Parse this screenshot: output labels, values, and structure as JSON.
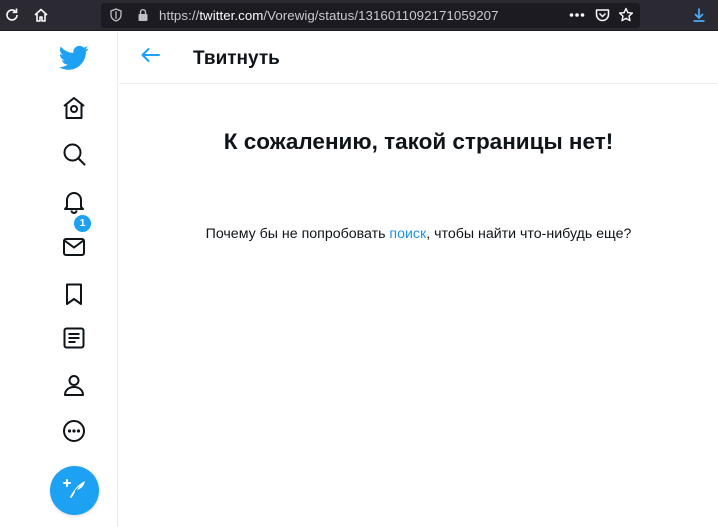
{
  "browser": {
    "url_host": "twitter.com",
    "url_path": "/Vorewig/status/1316011092171059207",
    "url_prefix": "https://",
    "icons": [
      "reload-icon",
      "home-icon",
      "tracking-protection-icon",
      "lock-icon",
      "page-actions-icon",
      "pocket-icon",
      "bookmark-star-icon",
      "download-icon"
    ],
    "accent_color": "#4aa8f5"
  },
  "nav": {
    "items": [
      "twitter-logo-icon",
      "home-icon",
      "explore-icon",
      "notifications-icon",
      "messages-icon",
      "bookmarks-icon",
      "lists-icon",
      "profile-icon",
      "more-icon"
    ],
    "notification_count": "1",
    "tweet_button_icon": "compose-tweet-icon"
  },
  "header": {
    "title": "Твитнуть"
  },
  "error": {
    "heading": "К сожалению, такой страницы нет!",
    "message_before": "Почему бы не попробовать ",
    "message_link": "поиск",
    "message_after": ", чтобы найти что-нибудь еще?"
  },
  "colors": {
    "brand": "#1da1f2",
    "text": "#0f1419",
    "link": "#1b95e0",
    "border": "#ebeef0"
  }
}
